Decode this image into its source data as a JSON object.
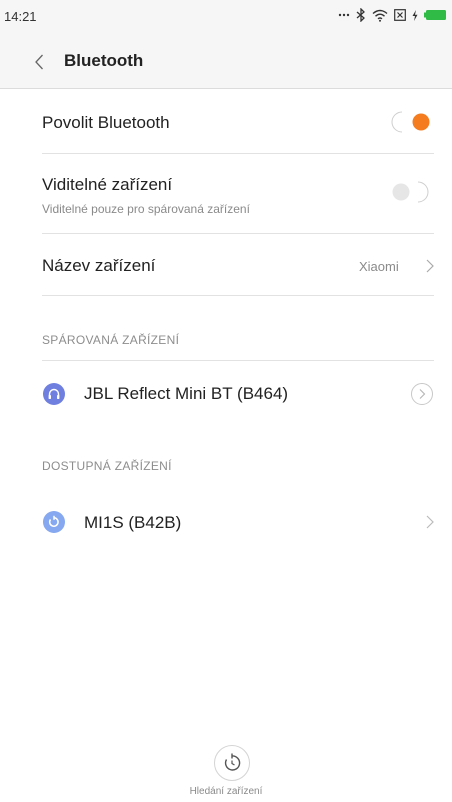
{
  "status_bar": {
    "time": "14:21",
    "icons": [
      "more-dots-icon",
      "bluetooth-icon",
      "wifi-icon",
      "sim-x-icon",
      "charging-icon",
      "battery-icon"
    ]
  },
  "header": {
    "title": "Bluetooth"
  },
  "settings": {
    "enable_bluetooth": {
      "label": "Povolit Bluetooth",
      "on": true
    },
    "visible_device": {
      "label": "Viditelné zařízení",
      "sublabel": "Viditelné pouze pro spárovaná zařízení",
      "on": false
    },
    "device_name": {
      "label": "Název zařízení",
      "value": "Xiaomi"
    }
  },
  "paired": {
    "header": "SPÁROVANÁ ZAŘÍZENÍ",
    "devices": [
      {
        "name": "JBL Reflect Mini BT (B464)",
        "icon": "headphones-icon"
      }
    ]
  },
  "available": {
    "header": "DOSTUPNÁ ZAŘÍZENÍ",
    "devices": [
      {
        "name": "MI1S (B42B)",
        "icon": "device-icon"
      }
    ]
  },
  "footer": {
    "search_label": "Hledání zařízení"
  },
  "colors": {
    "accent": "#f57c1f",
    "device_icon_blue": "#6f7fe0",
    "device_icon_light_blue": "#86a8f0",
    "divider": "#e2e2e2",
    "secondary_text": "#8a8a8a"
  }
}
